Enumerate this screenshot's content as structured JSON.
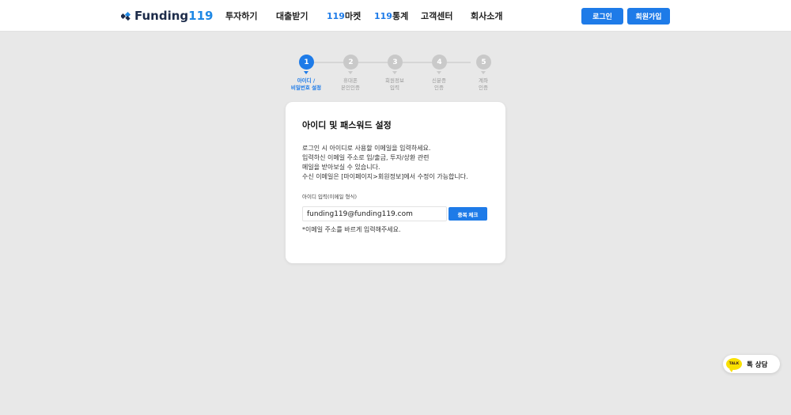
{
  "header": {
    "logo_text": "Funding",
    "logo_num": "119",
    "nav": [
      {
        "label": "투자하기"
      },
      {
        "label": "대출받기"
      },
      {
        "prefix": "119",
        "label": "마켓"
      },
      {
        "prefix": "119",
        "label": "통계"
      },
      {
        "label": "고객센터"
      },
      {
        "label": "회사소개"
      }
    ],
    "login_label": "로그인",
    "signup_label": "회원가입"
  },
  "steps": [
    {
      "num": "1",
      "line1": "아이디 /",
      "line2": "비밀번호 설정",
      "active": true
    },
    {
      "num": "2",
      "line1": "휴대폰",
      "line2": "본인인증",
      "active": false
    },
    {
      "num": "3",
      "line1": "회원정보",
      "line2": "입력",
      "active": false
    },
    {
      "num": "4",
      "line1": "신분증",
      "line2": "인증",
      "active": false
    },
    {
      "num": "5",
      "line1": "계좌",
      "line2": "인증",
      "active": false
    }
  ],
  "card": {
    "title": "아이디 및 패스워드 설정",
    "desc": [
      "로그인 시 아이디로 사용할 이메일을 입력하세요.",
      "입력하신 이메일 주소로 입/출금, 투자/상환 관련",
      "메일을 받아보실 수 있습니다.",
      "수신 이메일은 [마이페이지>회원정보]에서 수정이 가능합니다."
    ],
    "field_label": "아이디 입력(이메일 형식)",
    "email_value": "funding119@funding119.com",
    "dup_button": "중복 체크",
    "hint": "*이메일 주소를 바르게 입력해주세요."
  },
  "talk": {
    "badge": "TALK",
    "label": "톡 상담"
  },
  "colors": {
    "accent": "#1e7be8",
    "inactive_step": "#c9c9c9",
    "background": "#e8e8e8",
    "kakao": "#f9e000"
  }
}
